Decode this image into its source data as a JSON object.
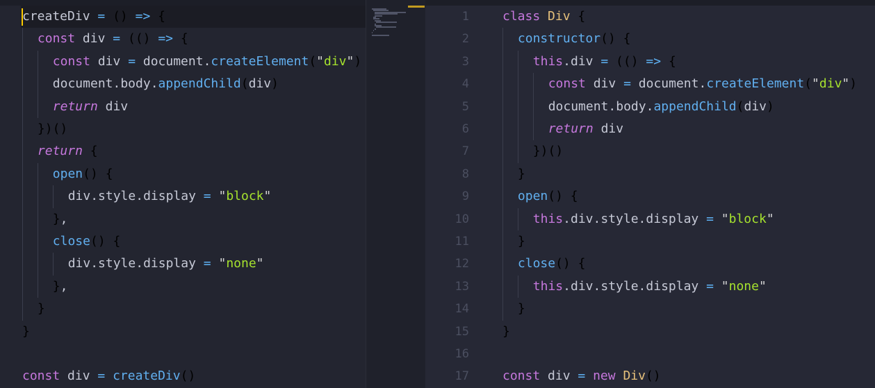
{
  "left_editor": {
    "lines": [
      [
        [
          "createDiv",
          "v"
        ],
        [
          " ",
          "p"
        ],
        [
          "=",
          "o"
        ],
        [
          " ",
          "p"
        ],
        [
          "(",
          "b1"
        ],
        [
          ")",
          "b1"
        ],
        [
          " ",
          "p"
        ],
        [
          "=>",
          "o"
        ],
        [
          " ",
          "p"
        ],
        [
          "{",
          "b1"
        ]
      ],
      [
        [
          "const",
          "k"
        ],
        [
          " ",
          "p"
        ],
        [
          "div",
          "v"
        ],
        [
          " ",
          "p"
        ],
        [
          "=",
          "o"
        ],
        [
          " ",
          "p"
        ],
        [
          "(",
          "b2"
        ],
        [
          "(",
          "b3"
        ],
        [
          ")",
          "b3"
        ],
        [
          " ",
          "p"
        ],
        [
          "=>",
          "o"
        ],
        [
          " ",
          "p"
        ],
        [
          "{",
          "b1"
        ]
      ],
      [
        [
          "const",
          "k"
        ],
        [
          " ",
          "p"
        ],
        [
          "div",
          "v"
        ],
        [
          " ",
          "p"
        ],
        [
          "=",
          "o"
        ],
        [
          " ",
          "p"
        ],
        [
          "document",
          "v"
        ],
        [
          ".",
          "p"
        ],
        [
          "createElement",
          "f"
        ],
        [
          "(",
          "b2"
        ],
        [
          "\"",
          "sq"
        ],
        [
          "div",
          "s"
        ],
        [
          "\"",
          "sq"
        ],
        [
          ")",
          "b2"
        ]
      ],
      [
        [
          "document",
          "v"
        ],
        [
          ".",
          "p"
        ],
        [
          "body",
          "v"
        ],
        [
          ".",
          "p"
        ],
        [
          "appendChild",
          "f"
        ],
        [
          "(",
          "b2"
        ],
        [
          "div",
          "v"
        ],
        [
          ")",
          "b2"
        ]
      ],
      [
        [
          "return",
          "ki"
        ],
        [
          " ",
          "p"
        ],
        [
          "div",
          "v"
        ]
      ],
      [
        [
          "}",
          "b1"
        ],
        [
          ")",
          "b2"
        ],
        [
          "(",
          "b2"
        ],
        [
          ")",
          "b2"
        ]
      ],
      [
        [
          "return",
          "ki"
        ],
        [
          " ",
          "p"
        ],
        [
          "{",
          "b2"
        ]
      ],
      [
        [
          "open",
          "f"
        ],
        [
          "(",
          "b3"
        ],
        [
          ")",
          "b3"
        ],
        [
          " ",
          "p"
        ],
        [
          "{",
          "b3"
        ]
      ],
      [
        [
          "div",
          "v"
        ],
        [
          ".",
          "p"
        ],
        [
          "style",
          "v"
        ],
        [
          ".",
          "p"
        ],
        [
          "display",
          "v"
        ],
        [
          " ",
          "p"
        ],
        [
          "=",
          "o"
        ],
        [
          " ",
          "p"
        ],
        [
          "\"",
          "sq"
        ],
        [
          "block",
          "s"
        ],
        [
          "\"",
          "sq"
        ]
      ],
      [
        [
          "}",
          "b3"
        ],
        [
          ",",
          "p"
        ]
      ],
      [
        [
          "close",
          "f"
        ],
        [
          "(",
          "b3"
        ],
        [
          ")",
          "b3"
        ],
        [
          " ",
          "p"
        ],
        [
          "{",
          "b3"
        ]
      ],
      [
        [
          "div",
          "v"
        ],
        [
          ".",
          "p"
        ],
        [
          "style",
          "v"
        ],
        [
          ".",
          "p"
        ],
        [
          "display",
          "v"
        ],
        [
          " ",
          "p"
        ],
        [
          "=",
          "o"
        ],
        [
          " ",
          "p"
        ],
        [
          "\"",
          "sq"
        ],
        [
          "none",
          "s"
        ],
        [
          "\"",
          "sq"
        ]
      ],
      [
        [
          "}",
          "b3"
        ],
        [
          ",",
          "p"
        ]
      ],
      [
        [
          "}",
          "b2"
        ]
      ],
      [
        [
          "}",
          "b1"
        ]
      ],
      [],
      [
        [
          "const",
          "k"
        ],
        [
          " ",
          "p"
        ],
        [
          "div",
          "v"
        ],
        [
          " ",
          "p"
        ],
        [
          "=",
          "o"
        ],
        [
          " ",
          "p"
        ],
        [
          "createDiv",
          "f"
        ],
        [
          "(",
          "b1"
        ],
        [
          ")",
          "b1"
        ]
      ]
    ]
  },
  "right_editor": {
    "line_numbers": [
      "1",
      "2",
      "3",
      "4",
      "5",
      "6",
      "7",
      "8",
      "9",
      "10",
      "11",
      "12",
      "13",
      "14",
      "15",
      "16",
      "17"
    ],
    "lines": [
      [
        [
          "class",
          "k"
        ],
        [
          " ",
          "p"
        ],
        [
          "Div",
          "c"
        ],
        [
          " ",
          "p"
        ],
        [
          "{",
          "b1"
        ]
      ],
      [
        [
          "constructor",
          "f"
        ],
        [
          "(",
          "b2"
        ],
        [
          ")",
          "b2"
        ],
        [
          " ",
          "p"
        ],
        [
          "{",
          "b2"
        ]
      ],
      [
        [
          "this",
          "k"
        ],
        [
          ".",
          "p"
        ],
        [
          "div",
          "v"
        ],
        [
          " ",
          "p"
        ],
        [
          "=",
          "o"
        ],
        [
          " ",
          "p"
        ],
        [
          "(",
          "b3"
        ],
        [
          "(",
          "b1"
        ],
        [
          ")",
          "b1"
        ],
        [
          " ",
          "p"
        ],
        [
          "=>",
          "o"
        ],
        [
          " ",
          "p"
        ],
        [
          "{",
          "b1"
        ]
      ],
      [
        [
          "const",
          "k"
        ],
        [
          " ",
          "p"
        ],
        [
          "div",
          "v"
        ],
        [
          " ",
          "p"
        ],
        [
          "=",
          "o"
        ],
        [
          " ",
          "p"
        ],
        [
          "document",
          "v"
        ],
        [
          ".",
          "p"
        ],
        [
          "createElement",
          "f"
        ],
        [
          "(",
          "b2"
        ],
        [
          "\"",
          "sq"
        ],
        [
          "div",
          "s"
        ],
        [
          "\"",
          "sq"
        ],
        [
          ")",
          "b2"
        ]
      ],
      [
        [
          "document",
          "v"
        ],
        [
          ".",
          "p"
        ],
        [
          "body",
          "v"
        ],
        [
          ".",
          "p"
        ],
        [
          "appendChild",
          "f"
        ],
        [
          "(",
          "b2"
        ],
        [
          "div",
          "v"
        ],
        [
          ")",
          "b2"
        ]
      ],
      [
        [
          "return",
          "ki"
        ],
        [
          " ",
          "p"
        ],
        [
          "div",
          "v"
        ]
      ],
      [
        [
          "}",
          "b1"
        ],
        [
          ")",
          "b3"
        ],
        [
          "(",
          "b3"
        ],
        [
          ")",
          "b3"
        ]
      ],
      [
        [
          "}",
          "b2"
        ]
      ],
      [
        [
          "open",
          "f"
        ],
        [
          "(",
          "b2"
        ],
        [
          ")",
          "b2"
        ],
        [
          " ",
          "p"
        ],
        [
          "{",
          "b2"
        ]
      ],
      [
        [
          "this",
          "k"
        ],
        [
          ".",
          "p"
        ],
        [
          "div",
          "v"
        ],
        [
          ".",
          "p"
        ],
        [
          "style",
          "v"
        ],
        [
          ".",
          "p"
        ],
        [
          "display",
          "v"
        ],
        [
          " ",
          "p"
        ],
        [
          "=",
          "o"
        ],
        [
          " ",
          "p"
        ],
        [
          "\"",
          "sq"
        ],
        [
          "block",
          "s"
        ],
        [
          "\"",
          "sq"
        ]
      ],
      [
        [
          "}",
          "b2"
        ]
      ],
      [
        [
          "close",
          "f"
        ],
        [
          "(",
          "b2"
        ],
        [
          ")",
          "b2"
        ],
        [
          " ",
          "p"
        ],
        [
          "{",
          "b2"
        ]
      ],
      [
        [
          "this",
          "k"
        ],
        [
          ".",
          "p"
        ],
        [
          "div",
          "v"
        ],
        [
          ".",
          "p"
        ],
        [
          "style",
          "v"
        ],
        [
          ".",
          "p"
        ],
        [
          "display",
          "v"
        ],
        [
          " ",
          "p"
        ],
        [
          "=",
          "o"
        ],
        [
          " ",
          "p"
        ],
        [
          "\"",
          "sq"
        ],
        [
          "none",
          "s"
        ],
        [
          "\"",
          "sq"
        ]
      ],
      [
        [
          "}",
          "b2"
        ]
      ],
      [
        [
          "}",
          "b1"
        ]
      ],
      [],
      [
        [
          "const",
          "k"
        ],
        [
          " ",
          "p"
        ],
        [
          "div",
          "v"
        ],
        [
          " ",
          "p"
        ],
        [
          "=",
          "o"
        ],
        [
          " ",
          "p"
        ],
        [
          "new",
          "k"
        ],
        [
          " ",
          "p"
        ],
        [
          "Div",
          "c"
        ],
        [
          "(",
          "b1"
        ],
        [
          ")",
          "b1"
        ]
      ]
    ]
  }
}
